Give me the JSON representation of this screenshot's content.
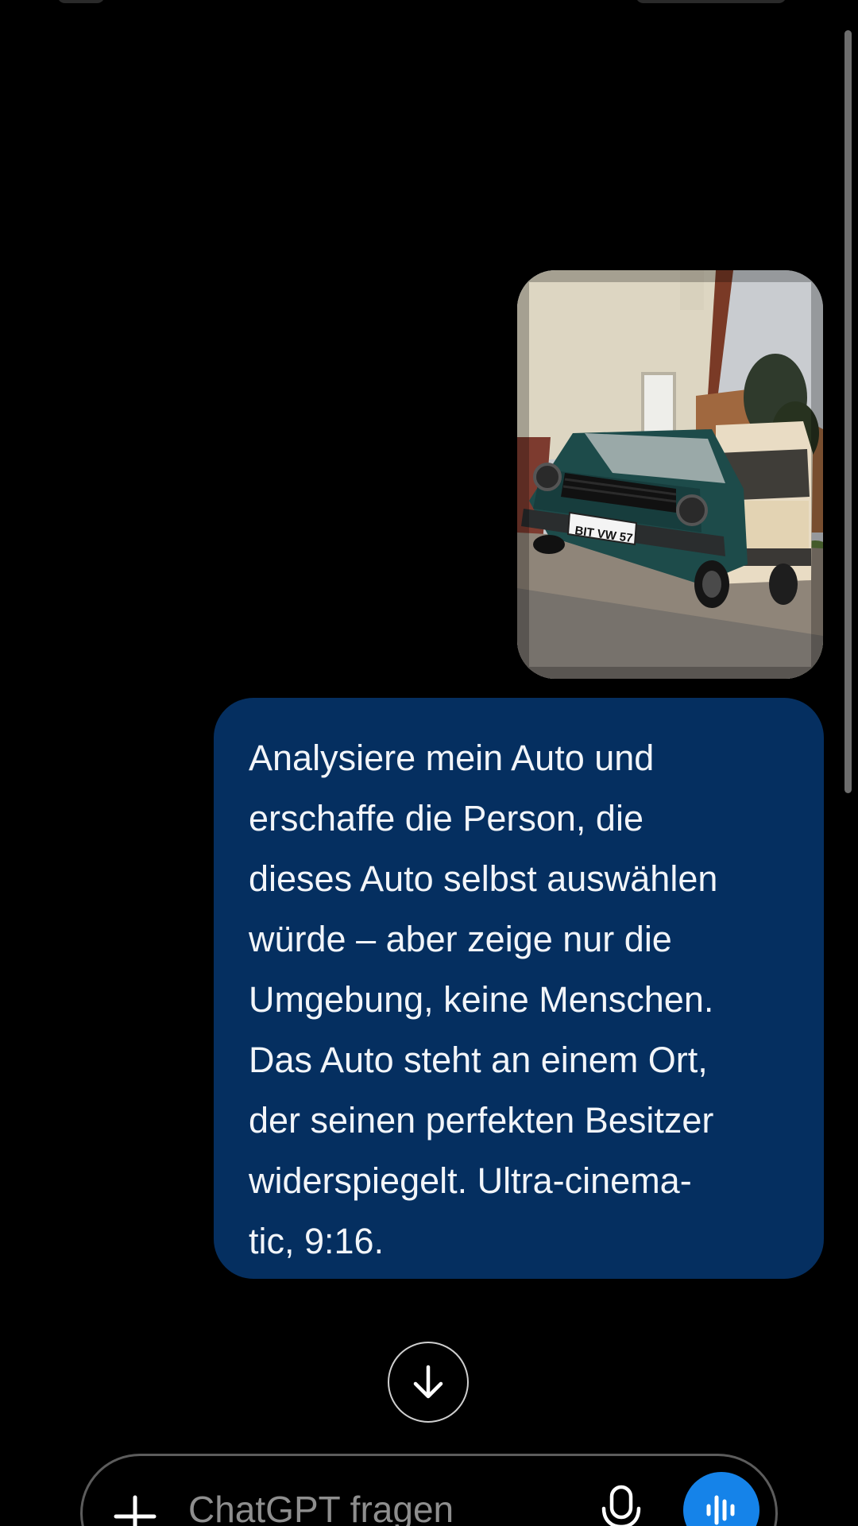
{
  "chat": {
    "attachment": {
      "plate_text": "BIT VW 57"
    },
    "user_message": "Analysiere mein Auto und\nerschaffe die Person, die\ndieses Auto selbst auswählen\nwürde – aber zeige nur die\nUmgebung, keine Menschen.\nDas Auto steht an einem Ort,\nder seinen perfekten Besitzer\nwiderspiegelt. Ultra-cinema-\ntic, 9:16."
  },
  "composer": {
    "placeholder": "ChatGPT fragen",
    "plus_icon": "plus-icon",
    "mic_icon": "microphone-icon",
    "voice_icon": "voice-waveform-icon"
  },
  "scroll_button": {
    "icon": "arrow-down-icon"
  },
  "colors": {
    "background": "#000000",
    "bubble": "#052f60",
    "voice_button": "#1583e9",
    "placeholder": "#8e8e8e"
  }
}
